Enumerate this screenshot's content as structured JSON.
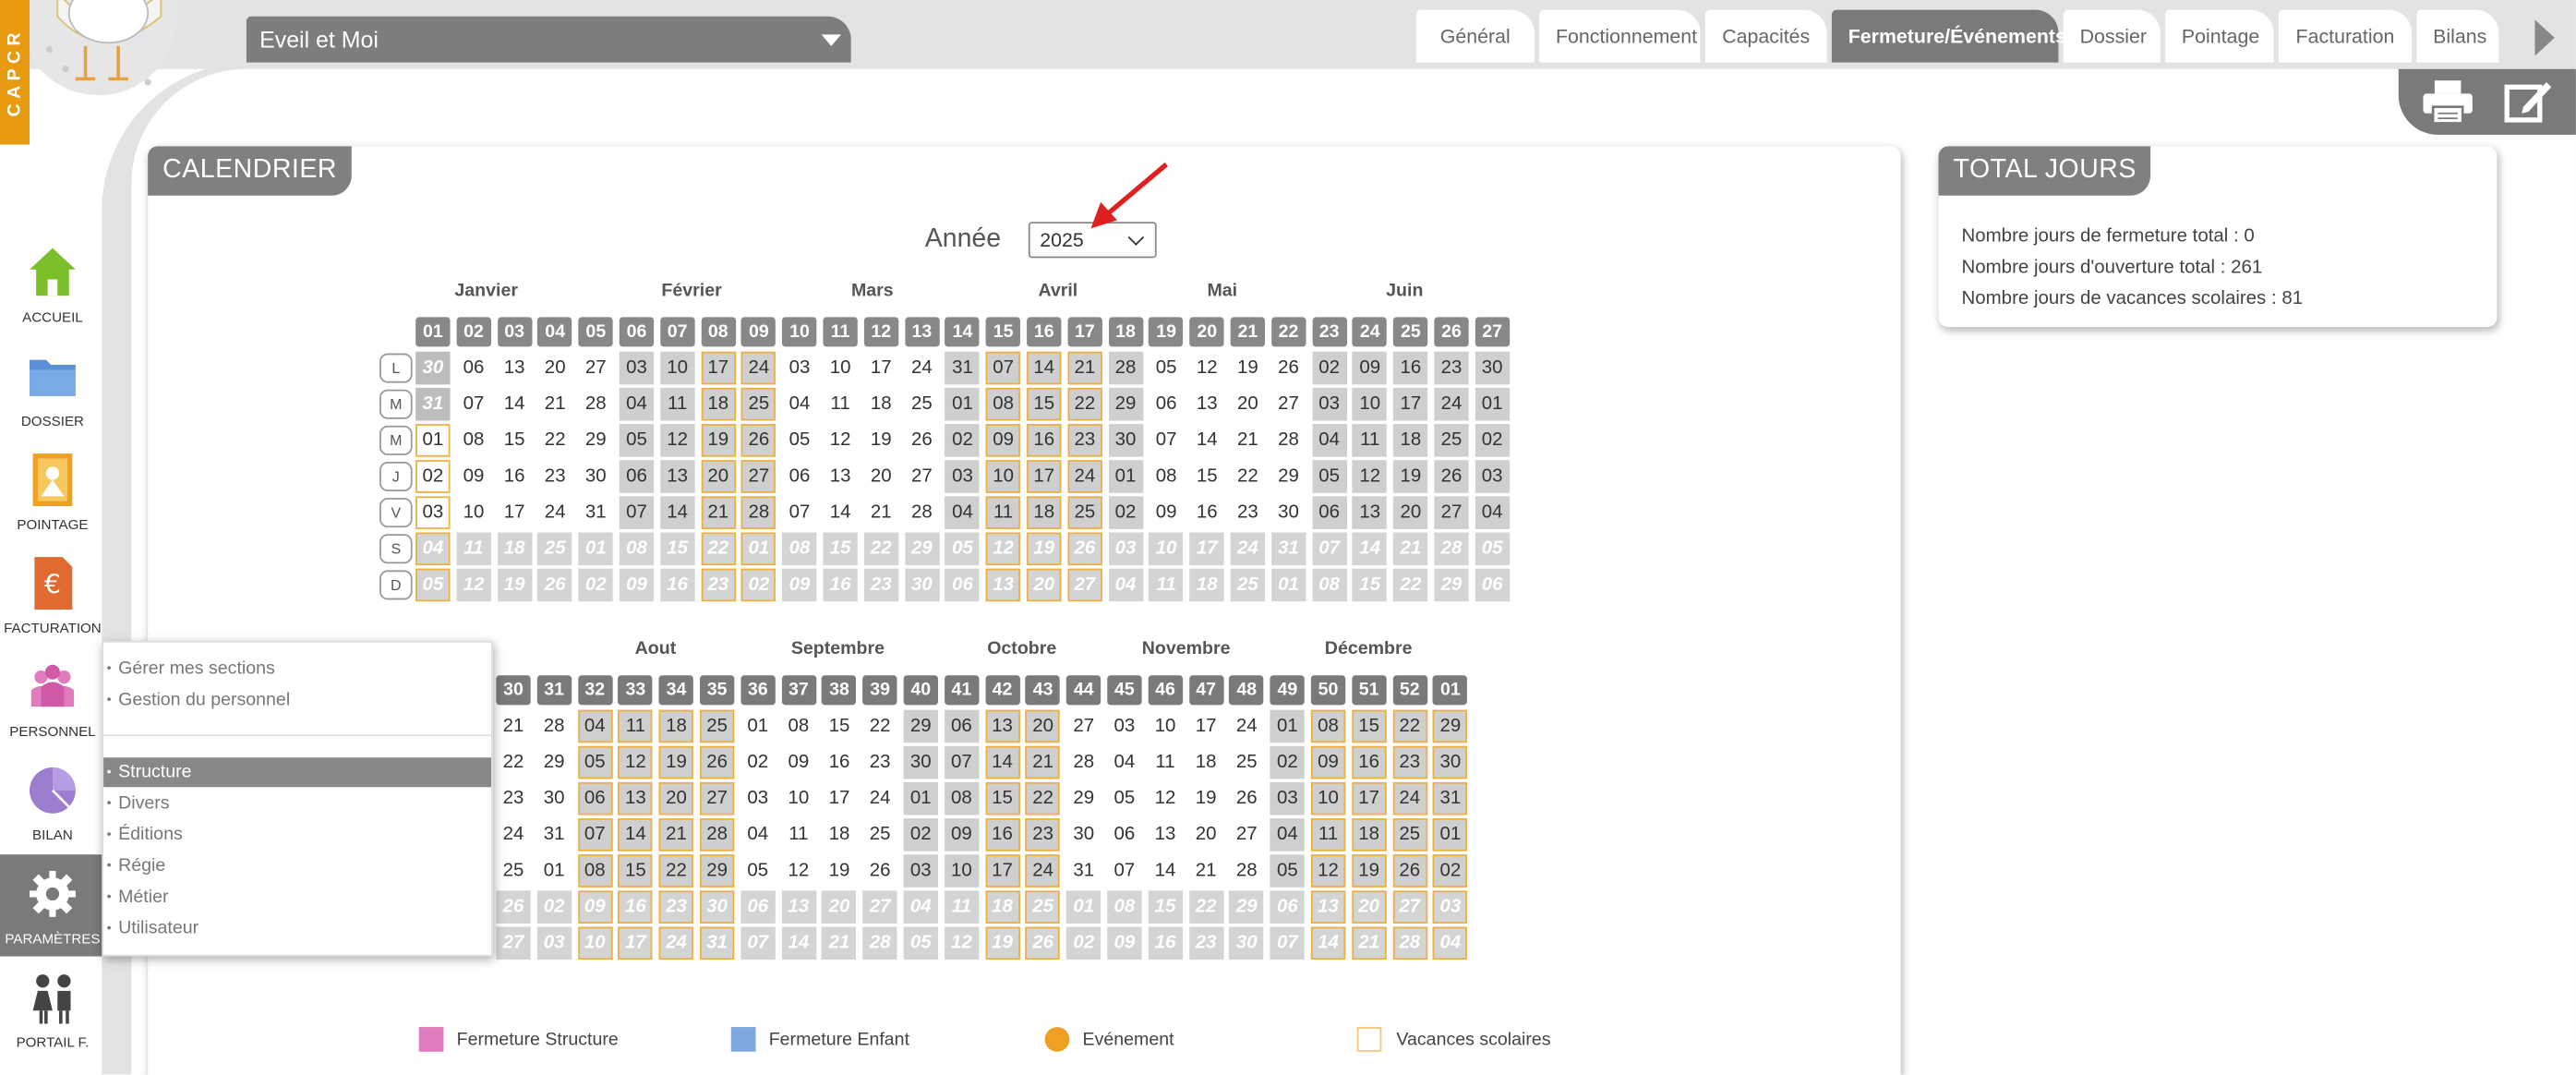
{
  "header": {
    "brand": "CAPCR",
    "structure_name": "Eveil et Moi",
    "tabs": [
      "Général",
      "Fonctionnement",
      "Capacités",
      "Fermeture/Événements",
      "Dossier",
      "Pointage",
      "Facturation",
      "Bilans"
    ],
    "active_tab": "Fermeture/Événements"
  },
  "toolbar": {
    "print_icon": "printer-icon",
    "edit_icon": "edit-icon"
  },
  "sidebar": [
    {
      "label": "ACCUEIL",
      "icon": "house-icon"
    },
    {
      "label": "DOSSIER",
      "icon": "folder-icon"
    },
    {
      "label": "POINTAGE",
      "icon": "pointage-icon"
    },
    {
      "label": "FACTURATION",
      "icon": "euro-invoice-icon"
    },
    {
      "label": "PERSONNEL",
      "icon": "people-icon"
    },
    {
      "label": "BILAN",
      "icon": "pie-chart-icon"
    },
    {
      "label": "PARAMÈTRES",
      "icon": "gear-icon"
    },
    {
      "label": "PORTAIL F.",
      "icon": "family-icon"
    }
  ],
  "menu": {
    "top_items": [
      "Gérer mes sections",
      "Gestion du personnel"
    ],
    "items": [
      "Structure",
      "Divers",
      "Éditions",
      "Régie",
      "Métier",
      "Utilisateur"
    ],
    "selected": "Structure"
  },
  "calendar": {
    "title": "CALENDRIER",
    "year_label": "Année",
    "year": "2025",
    "day_letters": [
      "L",
      "M",
      "M",
      "J",
      "V",
      "S",
      "D"
    ],
    "top_months": [
      "Janvier",
      "Février",
      "Mars",
      "Avril",
      "Mai",
      "Juin"
    ],
    "top_weeks": [
      "01",
      "02",
      "03",
      "04",
      "05",
      "06",
      "07",
      "08",
      "09",
      "10",
      "11",
      "12",
      "13",
      "14",
      "15",
      "16",
      "17",
      "18",
      "19",
      "20",
      "21",
      "22",
      "23",
      "24",
      "25",
      "26",
      "27"
    ],
    "top_rows": [
      [
        "30",
        "06",
        "13",
        "20",
        "27",
        "03",
        "10",
        "17",
        "24",
        "03",
        "10",
        "17",
        "24",
        "31",
        "07",
        "14",
        "21",
        "28",
        "05",
        "12",
        "19",
        "26",
        "02",
        "09",
        "16",
        "23",
        "30"
      ],
      [
        "31",
        "07",
        "14",
        "21",
        "28",
        "04",
        "11",
        "18",
        "25",
        "04",
        "11",
        "18",
        "25",
        "01",
        "08",
        "15",
        "22",
        "29",
        "06",
        "13",
        "20",
        "27",
        "03",
        "10",
        "17",
        "24",
        "01"
      ],
      [
        "01",
        "08",
        "15",
        "22",
        "29",
        "05",
        "12",
        "19",
        "26",
        "05",
        "12",
        "19",
        "26",
        "02",
        "09",
        "16",
        "23",
        "30",
        "07",
        "14",
        "21",
        "28",
        "04",
        "11",
        "18",
        "25",
        "02"
      ],
      [
        "02",
        "09",
        "16",
        "23",
        "30",
        "06",
        "13",
        "20",
        "27",
        "06",
        "13",
        "20",
        "27",
        "03",
        "10",
        "17",
        "24",
        "01",
        "08",
        "15",
        "22",
        "29",
        "05",
        "12",
        "19",
        "26",
        "03"
      ],
      [
        "03",
        "10",
        "17",
        "24",
        "31",
        "07",
        "14",
        "21",
        "28",
        "07",
        "14",
        "21",
        "28",
        "04",
        "11",
        "18",
        "25",
        "02",
        "09",
        "16",
        "23",
        "30",
        "06",
        "13",
        "20",
        "27",
        "04"
      ],
      [
        "04",
        "11",
        "18",
        "25",
        "01",
        "08",
        "15",
        "22",
        "01",
        "08",
        "15",
        "22",
        "29",
        "05",
        "12",
        "19",
        "26",
        "03",
        "10",
        "17",
        "24",
        "31",
        "07",
        "14",
        "21",
        "28",
        "05"
      ],
      [
        "05",
        "12",
        "19",
        "26",
        "02",
        "09",
        "16",
        "23",
        "02",
        "09",
        "16",
        "23",
        "30",
        "06",
        "13",
        "20",
        "27",
        "04",
        "11",
        "18",
        "25",
        "01",
        "08",
        "15",
        "22",
        "29",
        "06"
      ]
    ],
    "bottom_months": [
      "Aout",
      "Septembre",
      "Octobre",
      "Novembre",
      "Décembre"
    ],
    "bottom_weeks": [
      "30",
      "31",
      "32",
      "33",
      "34",
      "35",
      "36",
      "37",
      "38",
      "39",
      "40",
      "41",
      "42",
      "43",
      "44",
      "45",
      "46",
      "47",
      "48",
      "49",
      "50",
      "51",
      "52",
      "01"
    ],
    "bottom_rows": [
      [
        "21",
        "28",
        "04",
        "11",
        "18",
        "25",
        "01",
        "08",
        "15",
        "22",
        "29",
        "06",
        "13",
        "20",
        "27",
        "03",
        "10",
        "17",
        "24",
        "01",
        "08",
        "15",
        "22",
        "29"
      ],
      [
        "22",
        "29",
        "05",
        "12",
        "19",
        "26",
        "02",
        "09",
        "16",
        "23",
        "30",
        "07",
        "14",
        "21",
        "28",
        "04",
        "11",
        "18",
        "25",
        "02",
        "09",
        "16",
        "23",
        "30"
      ],
      [
        "23",
        "30",
        "06",
        "13",
        "20",
        "27",
        "03",
        "10",
        "17",
        "24",
        "01",
        "08",
        "15",
        "22",
        "29",
        "05",
        "12",
        "19",
        "26",
        "03",
        "10",
        "17",
        "24",
        "31"
      ],
      [
        "24",
        "31",
        "07",
        "14",
        "21",
        "28",
        "04",
        "11",
        "18",
        "25",
        "02",
        "09",
        "16",
        "23",
        "30",
        "06",
        "13",
        "20",
        "27",
        "04",
        "11",
        "18",
        "25",
        "01"
      ],
      [
        "25",
        "01",
        "08",
        "15",
        "22",
        "29",
        "05",
        "12",
        "19",
        "26",
        "03",
        "10",
        "17",
        "24",
        "31",
        "07",
        "14",
        "21",
        "28",
        "05",
        "12",
        "19",
        "26",
        "02"
      ],
      [
        "26",
        "02",
        "09",
        "16",
        "23",
        "30",
        "06",
        "13",
        "20",
        "27",
        "04",
        "11",
        "18",
        "25",
        "01",
        "08",
        "15",
        "22",
        "29",
        "06",
        "13",
        "20",
        "27",
        "03"
      ],
      [
        "27",
        "03",
        "10",
        "17",
        "24",
        "31",
        "07",
        "14",
        "21",
        "28",
        "05",
        "12",
        "19",
        "26",
        "02",
        "09",
        "16",
        "23",
        "30",
        "07",
        "14",
        "21",
        "28",
        "04"
      ]
    ]
  },
  "legend": [
    {
      "label": "Fermeture Structure",
      "color": "#e07bbd"
    },
    {
      "label": "Fermeture Enfant",
      "color": "#7fa8e0"
    },
    {
      "label": "Evénement",
      "color": "#f0a020"
    },
    {
      "label": "Vacances scolaires",
      "color": "#f5c878"
    }
  ],
  "totals": {
    "title": "TOTAL JOURS",
    "lines": [
      "Nombre jours de fermeture total : 0",
      "Nombre jours d'ouverture total : 261",
      "Nombre jours de vacances scolaires : 81"
    ]
  },
  "colors": {
    "accent_orange": "#e89a10",
    "grey_tab": "#7a7a7a",
    "vacances_border": "#f0b040"
  }
}
